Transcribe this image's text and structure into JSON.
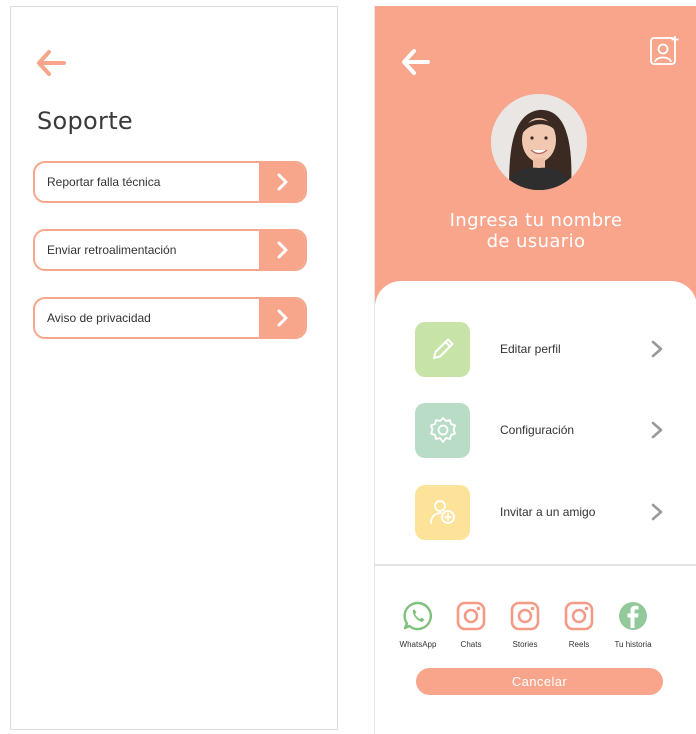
{
  "colors": {
    "accent": "#f9a58c",
    "edit_icon_bg": "#c7e3a8",
    "settings_icon_bg": "#b9dcc6",
    "invite_icon_bg": "#fde39a",
    "chevron": "#9a9a9a"
  },
  "support": {
    "back_icon": "arrow-left-icon",
    "title": "Soporte",
    "items": [
      {
        "label": "Reportar falla técnica",
        "icon": "chevron-right-icon"
      },
      {
        "label": "Enviar retroalimentación",
        "icon": "chevron-right-icon"
      },
      {
        "label": "Aviso de privacidad",
        "icon": "chevron-right-icon"
      }
    ]
  },
  "profile": {
    "back_icon": "arrow-left-icon",
    "add_user_icon": "add-user-icon",
    "username_line1": "Ingresa tu nombre",
    "username_line2": "de usuario",
    "menu": [
      {
        "label": "Editar perfil",
        "icon": "pencil-icon"
      },
      {
        "label": "Configuración",
        "icon": "gear-icon"
      },
      {
        "label": "Invitar a  un amigo",
        "icon": "invite-friend-icon"
      }
    ],
    "share": [
      {
        "label": "WhatsApp",
        "icon": "whatsapp-icon"
      },
      {
        "label": "Chats",
        "icon": "instagram-icon"
      },
      {
        "label": "Stories",
        "icon": "instagram-icon"
      },
      {
        "label": "Reels",
        "icon": "instagram-icon"
      },
      {
        "label": "Tu historia",
        "icon": "facebook-icon"
      }
    ],
    "cancel_label": "Cancelar"
  }
}
